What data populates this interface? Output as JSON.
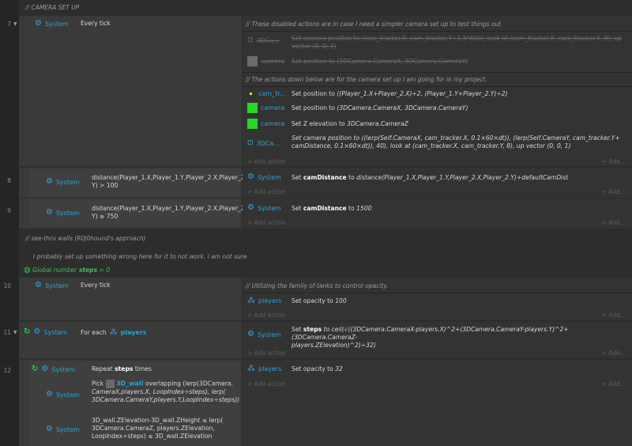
{
  "header": {
    "comment": "CAMERA SET UP"
  },
  "gutter": {
    "arrow": "▼"
  },
  "labels": {
    "system": "System",
    "add_action": "+ Add action",
    "add_more": "+ Add..."
  },
  "rows": [
    {
      "number": "7",
      "condition": "Every tick",
      "comments": [
        "These disabled actions are in case I need a simpler camera set up to test things out",
        "The actions down below are for the camera set up I am going for in my project."
      ],
      "disabled_actions": [
        {
          "object": "3DCa...",
          "text": "Set camera position to (cam_tracker.X, cam_tracker.Y+1.5*600), look at (cam_tracker.X, cam_tracker.Y, 8), up vector (0, 0, 1)"
        },
        {
          "object": "camera",
          "text": "Set position to (3DCamera.CameraX, 3DCamera.CameraY)"
        }
      ],
      "actions": [
        {
          "object": "cam_tr...",
          "prefix": "Set position to",
          "value": "((Player_1.X+Player_2.X)÷2, (Player_1.Y+Player_2.Y)÷2)"
        },
        {
          "object": "camera",
          "prefix": "Set position to",
          "value": "(3DCamera.CameraX, 3DCamera.CameraY)"
        },
        {
          "object": "camera",
          "prefix": "Set Z elevation to",
          "value": "3DCamera.CameraZ"
        },
        {
          "object": "3DCa...",
          "line1": "Set camera position to ((lerp(Self.CameraX, cam_tracker.X, 0.1×60×dt)), (lerp(Self.CameraY, cam_tracker.Y+",
          "line2": "camDistance, 0.1×60×dt)), 40), look at (cam_tracker.X, cam_tracker.Y, 8), up vector (0, 0, 1)"
        }
      ]
    },
    {
      "number": "8",
      "condition_line1": "distance(Player_1.X,Player_1.Y,Player_2.X,Player_2.",
      "condition_line2": "Y) > 100",
      "action_prefix": "Set",
      "action_var": "camDistance",
      "action_mid": "to",
      "action_value": "distance(Player_1.X,Player_1.Y,Player_2.X,Player_2.Y)+defaultCamDist"
    },
    {
      "number": "9",
      "condition_line1": "distance(Player_1.X,Player_1.Y,Player_2.X,Player_2.",
      "condition_line2": "Y) ≥ 750",
      "action_prefix": "Set",
      "action_var": "camDistance",
      "action_mid": "to",
      "action_value": "1500"
    }
  ],
  "comments": {
    "see_thru": "see-thru walls (R0J0hound's approach)",
    "note": "I probably set up something wrong here for it to not work. I am not sure"
  },
  "global": {
    "prefix": "Global number",
    "name": "steps",
    "suffix": "= 0"
  },
  "row10": {
    "number": "10",
    "condition": "Every tick",
    "comment": "Utilizing the family of tanks to control opacity.",
    "object": "players",
    "action": "Set opacity to",
    "value": "100"
  },
  "row11": {
    "number": "11",
    "for_each": "For each",
    "object": "players",
    "action_prefix": "Set",
    "action_var": "steps",
    "action_mid": "to ceil(√((3DCamera.CameraX-players.X)^2+(3DCamera.CameraY-players.Y)^2+(3DCamera.CameraZ-",
    "action_line2": "players.ZElevation)^2)÷32)"
  },
  "row12": {
    "number": "12",
    "repeat_prefix": "Repeat",
    "repeat_var": "steps",
    "repeat_suffix": "times",
    "pick_prefix": "Pick",
    "pick_obj": "3D_wall",
    "pick_mid": "overlapping (lerp(3DCamera.",
    "pick_line2": "CameraX,players.X, LoopIndex÷steps), lerp(",
    "pick_line3": "3DCamera.CameraY,players.Y,LoopIndex÷steps))",
    "cond_line1": "3D_wall.ZElevation-3D_wall.ZHeight ≤ lerp(",
    "cond_line2": "3DCamera.CameraZ, players.ZElevation,",
    "cond_line3": "LoopIndex÷steps) ≤ 3D_wall.ZElevation",
    "object": "players",
    "action": "Set opacity to",
    "value": "32"
  },
  "colors": {
    "accent": "#2ba3d6",
    "loop": "#36c35a",
    "sprite": "#27d827",
    "background": "#2d2d2d"
  }
}
